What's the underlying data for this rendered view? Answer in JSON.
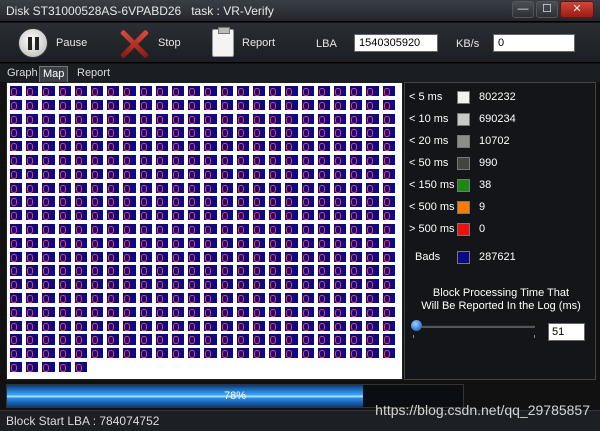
{
  "window": {
    "title": "Disk ST31000528AS-6VPABD26   task : VR-Verify",
    "minimize": "—",
    "maximize": "☐",
    "close": "✕"
  },
  "toolbar": {
    "pause_label": "Pause",
    "stop_label": "Stop",
    "report_label": "Report",
    "lba_label": "LBA",
    "lba_value": "1540305920",
    "kbs_label": "KB/s",
    "kbs_value": "0"
  },
  "tabs": [
    {
      "label": "Graph"
    },
    {
      "label": "Map",
      "active": true
    },
    {
      "label": "Report"
    }
  ],
  "map": {
    "cell_color": "#0b0a84",
    "cell_outline_color": "#ff3a3a",
    "cols": 24,
    "full_rows": 20,
    "last_row_cells": 5
  },
  "legend": [
    {
      "label": "< 5 ms",
      "color": "#f2f2f2",
      "value": "802232"
    },
    {
      "label": "< 10 ms",
      "color": "#c8c8c8",
      "value": "690234"
    },
    {
      "label": "< 20 ms",
      "color": "#8c8c8c",
      "value": "10702"
    },
    {
      "label": "< 50 ms",
      "color": "#444444",
      "value": "990"
    },
    {
      "label": "< 150 ms",
      "color": "#1a8a12",
      "value": "38"
    },
    {
      "label": "< 500 ms",
      "color": "#ff7a00",
      "value": "9"
    },
    {
      "label": "> 500 ms",
      "color": "#ee1010",
      "value": "0"
    },
    {
      "label": "Bads",
      "color": "#0b0a84",
      "value": "287621"
    }
  ],
  "settings": {
    "bpt_line1": "Block Processing Time That",
    "bpt_line2": "Will Be Reported In the Log (ms)",
    "bpt_value": "51",
    "slider_level_fraction": 0.0
  },
  "progress": {
    "percent": 78,
    "text": "78%"
  },
  "status": {
    "text": "Block Start LBA : 784074752"
  },
  "watermark": "https://blog.csdn.net/qq_29785857"
}
